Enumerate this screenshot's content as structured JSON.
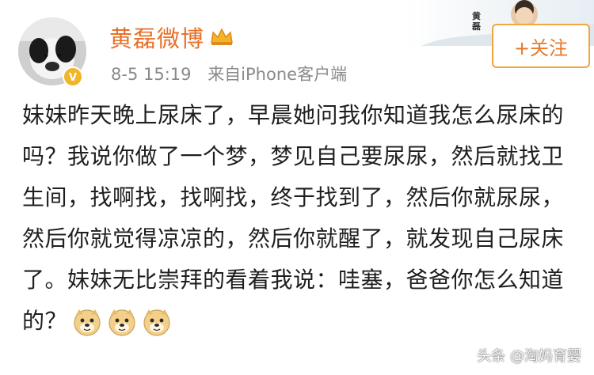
{
  "post": {
    "author": "黄磊微博",
    "date": "8-5 15:19",
    "source": "来自iPhone客户端",
    "follow_label": "+关注",
    "header_stamp": "黄 磊",
    "text": "妹妹昨天晚上尿床了，早晨她问我你知道我怎么尿床的吗？我说你做了一个梦，梦见自己要尿尿，然后就找卫生间，找啊找，找啊找，终于找到了，然后你就尿尿，然后你就觉得凉凉的，然后你就醒了，就发现自己尿床了。妹妹无比崇拜的看着我说：哇塞，爸爸你怎么知道的？",
    "emojis": [
      "doge-emoji",
      "doge-emoji",
      "doge-emoji"
    ]
  },
  "watermark": "头条 @淘妈育婴",
  "colors": {
    "name": "#e8702a",
    "follow_border": "#f0a63c",
    "meta": "#8a8a8a",
    "verified_badge": "#f2b52a"
  }
}
